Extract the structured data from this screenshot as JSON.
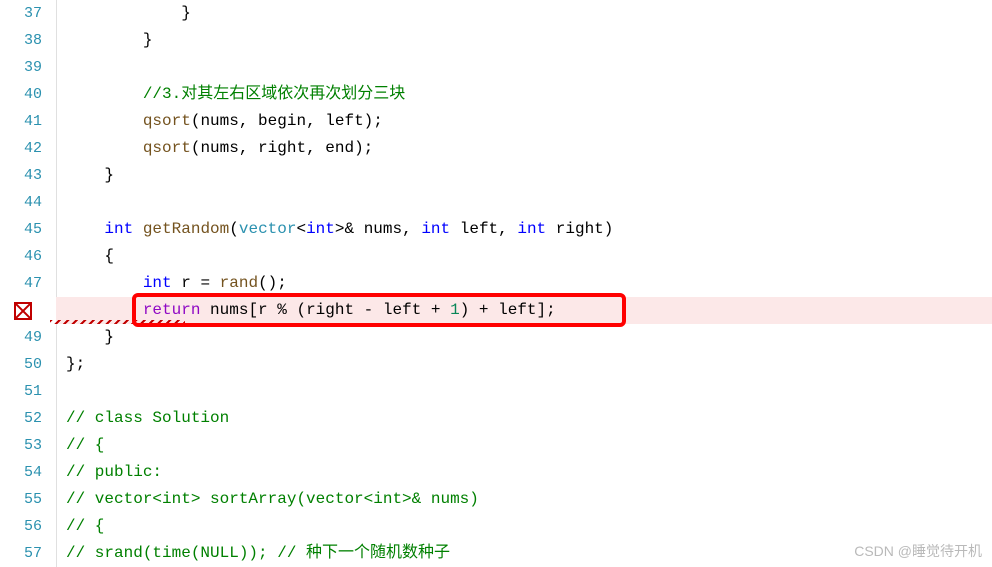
{
  "lines": {
    "l37": "37",
    "l38": "38",
    "l39": "39",
    "l40": "40",
    "l41": "41",
    "l42": "42",
    "l43": "43",
    "l44": "44",
    "l45": "45",
    "l46": "46",
    "l47": "47",
    "l49": "49",
    "l50": "50",
    "l51": "51",
    "l52": "52",
    "l53": "53",
    "l54": "54",
    "l55": "55",
    "l56": "56",
    "l57": "57"
  },
  "code": {
    "c37_brace": "            }",
    "c38_brace": "        }",
    "c39": " ",
    "c40_indent": "        ",
    "c40_comment": "//3.对其左右区域依次再次划分三块",
    "c41_indent": "        ",
    "c41_fn": "qsort",
    "c41_args_open": "(",
    "c41_nums": "nums",
    "c41_sep1": ", ",
    "c41_begin": "begin",
    "c41_sep2": ", ",
    "c41_left": "left",
    "c41_close": ");",
    "c42_indent": "        ",
    "c42_fn": "qsort",
    "c42_args_open": "(",
    "c42_nums": "nums",
    "c42_sep1": ", ",
    "c42_right": "right",
    "c42_sep2": ", ",
    "c42_end": "end",
    "c42_close": ");",
    "c43_brace": "    }",
    "c44": " ",
    "c45_indent": "    ",
    "c45_int": "int",
    "c45_sp1": " ",
    "c45_fn": "getRandom",
    "c45_open": "(",
    "c45_vector": "vector",
    "c45_lt": "<",
    "c45_int2": "int",
    "c45_gt": ">& ",
    "c45_nums": "nums",
    "c45_sep1": ", ",
    "c45_int3": "int",
    "c45_sp2": " ",
    "c45_left": "left",
    "c45_sep2": ", ",
    "c45_int4": "int",
    "c45_sp3": " ",
    "c45_right": "right",
    "c45_close": ")",
    "c46_brace": "    {",
    "c47_indent": "        ",
    "c47_int": "int",
    "c47_sp": " ",
    "c47_r": "r",
    "c47_eq": " = ",
    "c47_rand": "rand",
    "c47_close": "();",
    "c48_indent": "        ",
    "c48_return": "return",
    "c48_sp": " ",
    "c48_nums": "nums",
    "c48_open": "[",
    "c48_r": "r",
    "c48_mod": " % (",
    "c48_right": "right",
    "c48_minus": " - ",
    "c48_left": "left",
    "c48_plus": " + ",
    "c48_one": "1",
    "c48_close1": ") + ",
    "c48_left2": "left",
    "c48_close2": "];",
    "c49_brace": "    }",
    "c50_brace": "};",
    "c51": " ",
    "c52_comment": "// class Solution",
    "c53_comment": "// {",
    "c54_comment": "// public:",
    "c55_comment": "// vector<int> sortArray(vector<int>& nums)",
    "c56_comment": "// {",
    "c57_comment1": "// srand(time(NULL)); ",
    "c57_comment2": "// 种下一个随机数种子"
  },
  "watermark": "CSDN @睡觉待开机"
}
